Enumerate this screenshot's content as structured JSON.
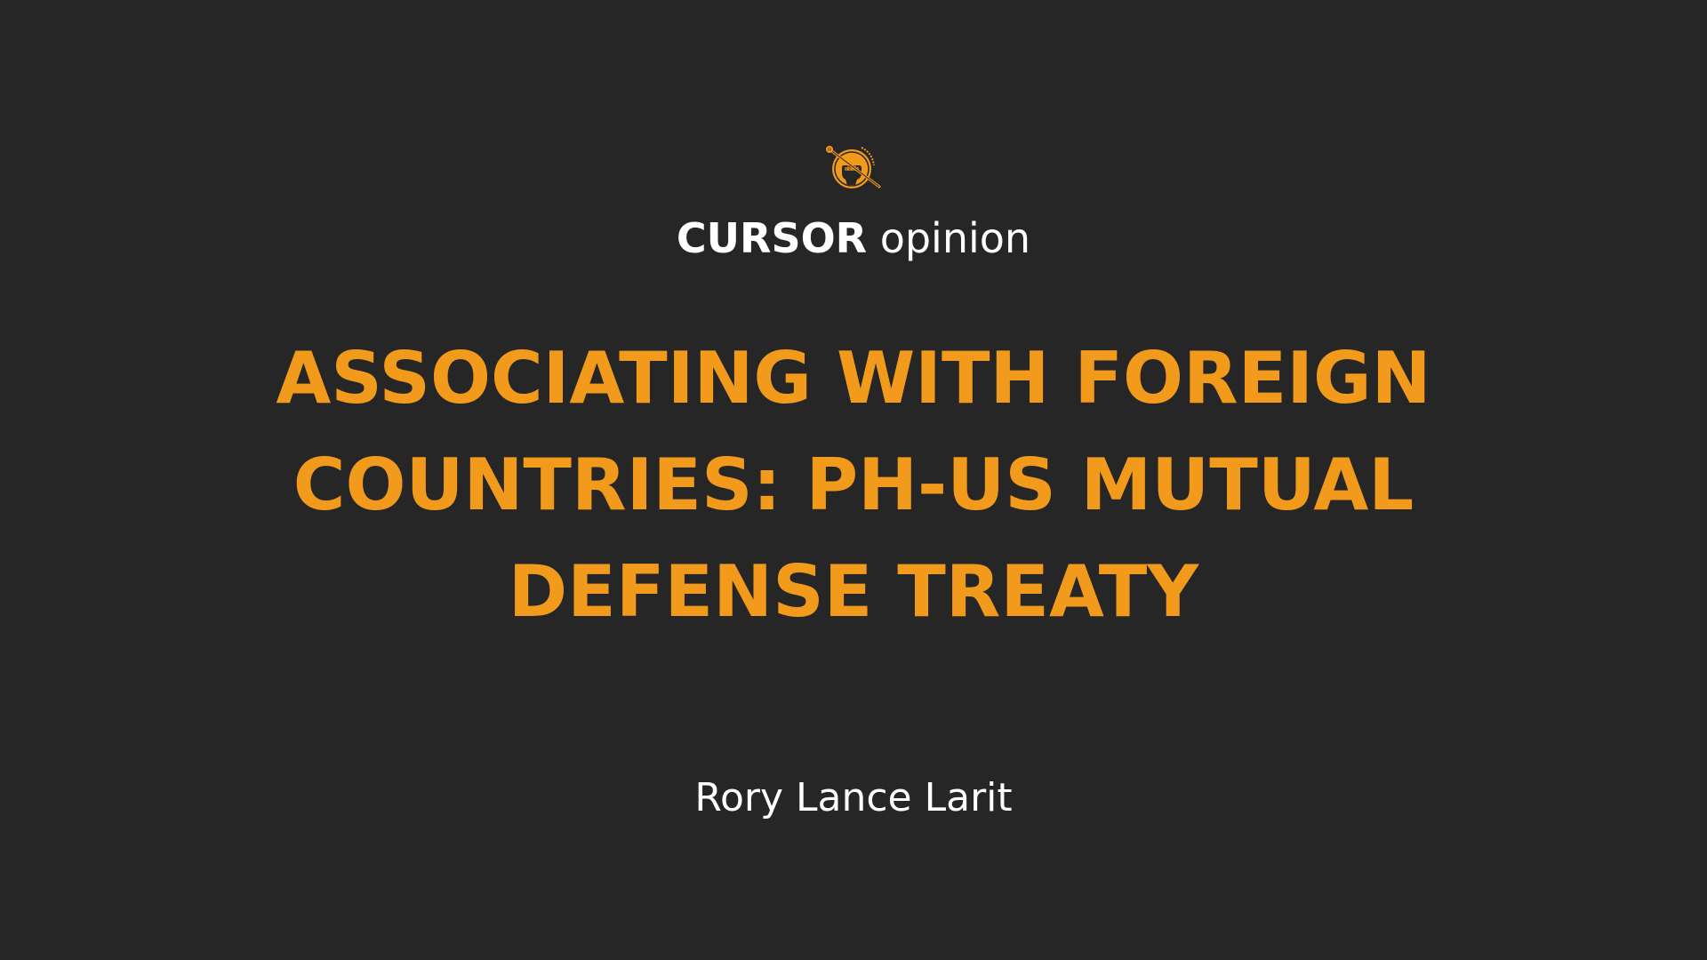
{
  "logo": {
    "icon": "fist-pen-emblem-icon",
    "arc_text": "Lumen ad Mortem",
    "color": "#f29a1c"
  },
  "masthead": {
    "brand": "CURSOR",
    "section": "opinion"
  },
  "headline": {
    "lines": [
      "ASSOCIATING WITH FOREIGN",
      "COUNTRIES: PH-US MUTUAL",
      "DEFENSE TREATY"
    ]
  },
  "author": {
    "name": "Rory Lance Larit"
  },
  "colors": {
    "background": "#262626",
    "accent": "#f29a1c",
    "text": "#ffffff"
  }
}
